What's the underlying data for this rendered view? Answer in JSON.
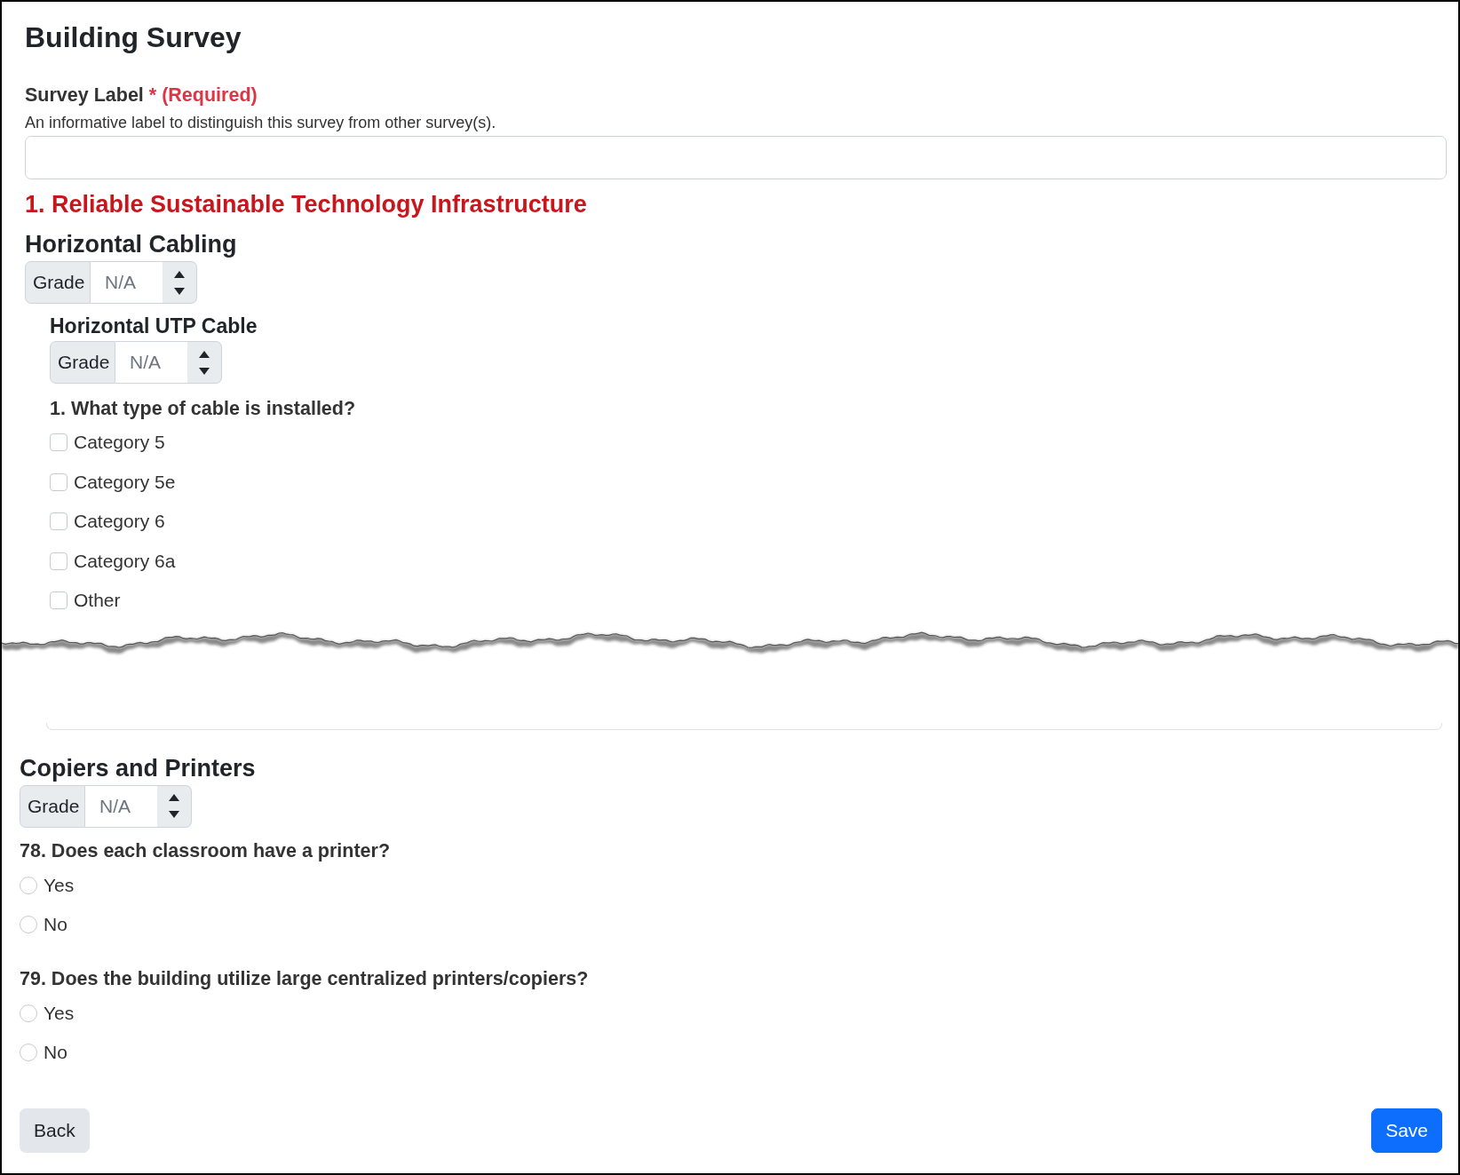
{
  "form": {
    "title": "Building Survey"
  },
  "survey_label": {
    "label": "Survey Label",
    "required_note": "* (Required)",
    "hint": "An informative label to distinguish this survey from other survey(s)."
  },
  "section": {
    "title": "1. Reliable Sustainable Technology Infrastructure"
  },
  "excerpts": [
    {
      "categories": [
        {
          "title": "Horizontal Cabling",
          "grade": {
            "label": "Grade",
            "placeholder": "N/A"
          },
          "subcategories": [
            {
              "title": "Horizontal UTP Cable",
              "grade": {
                "label": "Grade",
                "placeholder": "N/A"
              },
              "questions": [
                {
                  "kind": "checkboxes",
                  "text": "1. What type of cable is installed?",
                  "options": [
                    {
                      "label": "Category 5",
                      "checked": false
                    },
                    {
                      "label": "Category 5e",
                      "checked": false
                    },
                    {
                      "label": "Category 6",
                      "checked": false
                    },
                    {
                      "label": "Category 6a",
                      "checked": false
                    },
                    {
                      "label": "Other",
                      "checked": false
                    }
                  ]
                }
              ]
            }
          ]
        }
      ]
    },
    {
      "categories": [
        {
          "title": "Copiers and Printers",
          "grade": {
            "label": "Grade",
            "placeholder": "N/A"
          },
          "questions": [
            {
              "kind": "radio",
              "text": "78. Does each classroom have a printer?",
              "options": [
                {
                  "label": "Yes",
                  "selected": false
                },
                {
                  "label": "No",
                  "selected": false
                }
              ]
            },
            {
              "kind": "radio",
              "text": "79. Does the building utilize large centralized printers/copiers?",
              "options": [
                {
                  "label": "Yes",
                  "selected": false
                },
                {
                  "label": "No",
                  "selected": false
                }
              ]
            }
          ]
        }
      ]
    }
  ],
  "buttons": [
    {
      "kind": "secondary",
      "label": "Back"
    },
    {
      "kind": "primary",
      "label": "Save"
    }
  ]
}
